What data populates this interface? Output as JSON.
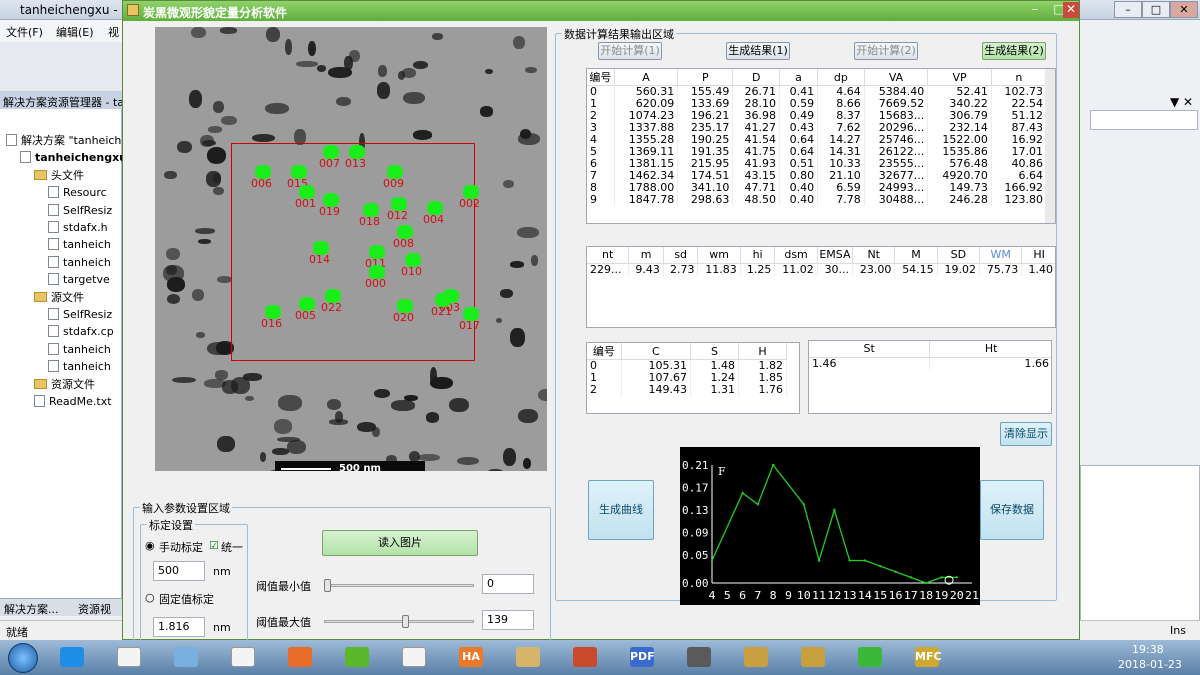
{
  "vs": {
    "title": "tanheichengxu - Mi",
    "menu": [
      "文件(F)",
      "编辑(E)",
      "视"
    ],
    "explorer_title": "解决方案资源管理器 - ta",
    "tree": [
      {
        "label": "解决方案 \"tanheich",
        "indent": 0,
        "kind": "file"
      },
      {
        "label": "tanheichengxu",
        "indent": 1,
        "kind": "file",
        "bold": true
      },
      {
        "label": "头文件",
        "indent": 2,
        "kind": "folder"
      },
      {
        "label": "Resourc",
        "indent": 3,
        "kind": "file"
      },
      {
        "label": "SelfResiz",
        "indent": 3,
        "kind": "file"
      },
      {
        "label": "stdafx.h",
        "indent": 3,
        "kind": "file"
      },
      {
        "label": "tanheich",
        "indent": 3,
        "kind": "file"
      },
      {
        "label": "tanheich",
        "indent": 3,
        "kind": "file"
      },
      {
        "label": "targetve",
        "indent": 3,
        "kind": "file"
      },
      {
        "label": "源文件",
        "indent": 2,
        "kind": "folder"
      },
      {
        "label": "SelfResiz",
        "indent": 3,
        "kind": "file"
      },
      {
        "label": "stdafx.cp",
        "indent": 3,
        "kind": "file"
      },
      {
        "label": "tanheich",
        "indent": 3,
        "kind": "file"
      },
      {
        "label": "tanheich",
        "indent": 3,
        "kind": "file"
      },
      {
        "label": "资源文件",
        "indent": 2,
        "kind": "folder"
      },
      {
        "label": "ReadMe.txt",
        "indent": 2,
        "kind": "file"
      }
    ],
    "bottom_tabs": [
      "解决方案...",
      "资源视"
    ],
    "status_left": "就绪",
    "status_right": "Ins"
  },
  "app": {
    "title": "炭黑微观形貌定量分析软件",
    "scale_label": "500 nm",
    "particle_labels": [
      "006",
      "015",
      "007",
      "013",
      "009",
      "001",
      "019",
      "018",
      "012",
      "004",
      "002",
      "008",
      "014",
      "011",
      "010",
      "000",
      "003",
      "016",
      "005",
      "022",
      "020",
      "021",
      "017"
    ],
    "input_group": {
      "title": "输入参数设置区域",
      "calib_group_title": "标定设置",
      "manual_label": "手动标定",
      "unify_label": "统一",
      "length_value": "500",
      "length_unit": "nm",
      "fixed_label": "固定值标定",
      "fixed_value": "1.816",
      "fixed_unit": "nm",
      "read_button": "读入图片",
      "thresh_min_label": "阈值最小值",
      "thresh_min_value": "0",
      "thresh_min_level": 0,
      "thresh_max_label": "阈值最大值",
      "thresh_max_value": "139",
      "thresh_max_level": 0.545
    },
    "output_group": {
      "title": "数据计算结果输出区域",
      "buttons": [
        "开始计算(1)",
        "生成结果(1)",
        "开始计算(2)",
        "生成结果(2)"
      ],
      "table1": {
        "columns": [
          "编号",
          "A",
          "P",
          "D",
          "a",
          "dp",
          "VA",
          "VP",
          "n"
        ],
        "rows": [
          [
            "0",
            "560.31",
            "155.49",
            "26.71",
            "0.41",
            "4.64",
            "5384.40",
            "52.41",
            "102.73"
          ],
          [
            "1",
            "620.09",
            "133.69",
            "28.10",
            "0.59",
            "8.66",
            "7669.52",
            "340.22",
            "22.54"
          ],
          [
            "2",
            "1074.23",
            "196.21",
            "36.98",
            "0.49",
            "8.37",
            "15683...",
            "306.79",
            "51.12"
          ],
          [
            "3",
            "1337.88",
            "235.17",
            "41.27",
            "0.43",
            "7.62",
            "20296...",
            "232.14",
            "87.43"
          ],
          [
            "4",
            "1355.28",
            "190.25",
            "41.54",
            "0.64",
            "14.27",
            "25746...",
            "1522.00",
            "16.92"
          ],
          [
            "5",
            "1369.11",
            "191.35",
            "41.75",
            "0.64",
            "14.31",
            "26122...",
            "1535.86",
            "17.01"
          ],
          [
            "6",
            "1381.15",
            "215.95",
            "41.93",
            "0.51",
            "10.33",
            "23555...",
            "576.48",
            "40.86"
          ],
          [
            "7",
            "1462.34",
            "174.51",
            "43.15",
            "0.80",
            "21.10",
            "32677...",
            "4920.70",
            "6.64"
          ],
          [
            "8",
            "1788.00",
            "341.10",
            "47.71",
            "0.40",
            "6.59",
            "24993...",
            "149.73",
            "166.92"
          ],
          [
            "9",
            "1847.78",
            "298.63",
            "48.50",
            "0.40",
            "7.78",
            "30488...",
            "246.28",
            "123.80"
          ]
        ]
      },
      "table2": {
        "columns": [
          "nt",
          "m",
          "sd",
          "wm",
          "hi",
          "dsm",
          "EMSA",
          "Nt",
          "M",
          "SD",
          "WM",
          "HI"
        ],
        "row": [
          "229...",
          "9.43",
          "2.73",
          "11.83",
          "1.25",
          "11.02",
          "30...",
          "23.00",
          "54.15",
          "19.02",
          "75.73",
          "1.40"
        ]
      },
      "table3": {
        "columns": [
          "编号",
          "C",
          "S",
          "H"
        ],
        "rows": [
          [
            "0",
            "105.31",
            "1.48",
            "1.82"
          ],
          [
            "1",
            "107.67",
            "1.24",
            "1.85"
          ],
          [
            "2",
            "149.43",
            "1.31",
            "1.76"
          ]
        ]
      },
      "table4": {
        "columns": [
          "St",
          "Ht"
        ],
        "row": [
          "1.46",
          "1.66"
        ]
      },
      "clear_button": "清除显示",
      "gen_curve_button": "生成曲线",
      "save_button": "保存数据"
    }
  },
  "chart_data": {
    "type": "line",
    "ylabel": "F",
    "ylim": [
      0,
      0.21
    ],
    "yticks": [
      "0.21",
      "0.17",
      "0.13",
      "0.09",
      "0.05",
      "0.00"
    ],
    "xticks": [
      "4",
      "5",
      "6",
      "7",
      "8",
      "9",
      "10",
      "11",
      "12",
      "13",
      "14",
      "15",
      "16",
      "17",
      "18",
      "19",
      "20",
      "21"
    ],
    "x": [
      4,
      6,
      7,
      8,
      10,
      11,
      12,
      13,
      14,
      15,
      16,
      17,
      18,
      19,
      20
    ],
    "y": [
      0.04,
      0.16,
      0.14,
      0.21,
      0.14,
      0.04,
      0.13,
      0.04,
      0.04,
      0.03,
      0.02,
      0.01,
      0.0,
      0.01,
      0.01
    ],
    "line_color": "#22cc22",
    "background": "#000000"
  },
  "taskbar": {
    "time": "19:38",
    "date": "2018-01-23",
    "apps": [
      "start",
      "ie",
      "file",
      "notepad",
      "file",
      "ppt",
      "360",
      "file",
      "HA",
      "paint",
      "link",
      "PDF",
      "camera",
      "tool",
      "tool",
      "clover",
      "MFC"
    ]
  }
}
